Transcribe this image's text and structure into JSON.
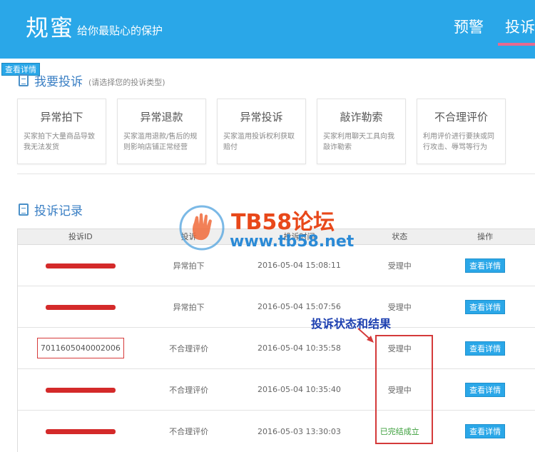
{
  "header": {
    "logo": "规蜜",
    "slogan": "给你最贴心的保护",
    "nav": [
      {
        "label": "预警"
      },
      {
        "label": "投诉"
      }
    ]
  },
  "float_button": "查看详情",
  "complain_section": {
    "title": "我要投诉",
    "subtitle": "(请选择您的投诉类型)",
    "cards": [
      {
        "title": "异常拍下",
        "desc": "买家拍下大量商品导致我无法发货"
      },
      {
        "title": "异常退款",
        "desc": "买家滥用退款/售后的规则影响店铺正常经营"
      },
      {
        "title": "异常投诉",
        "desc": "买家滥用投诉权利获取赔付"
      },
      {
        "title": "敲诈勒索",
        "desc": "买家利用聊天工具向我敲诈勒索"
      },
      {
        "title": "不合理评价",
        "desc": "利用评价进行要挟或同行攻击、辱骂等行为"
      }
    ]
  },
  "records_section": {
    "title": "投诉记录",
    "columns": [
      "投诉ID",
      "投诉",
      "投诉时间",
      "状态",
      "操作"
    ],
    "rows": [
      {
        "id": "",
        "type": "异常拍下",
        "time": "2016-05-04 15:08:11",
        "status": "受理中",
        "action": "查看详情"
      },
      {
        "id": "",
        "type": "异常拍下",
        "time": "2016-05-04 15:07:56",
        "status": "受理中",
        "action": "查看详情"
      },
      {
        "id": "7011605040002006",
        "type": "不合理评价",
        "time": "2016-05-04 10:35:58",
        "status": "受理中",
        "action": "查看详情"
      },
      {
        "id": "",
        "type": "不合理评价",
        "time": "2016-05-04 10:35:40",
        "status": "受理中",
        "action": "查看详情"
      },
      {
        "id": "",
        "type": "不合理评价",
        "time": "2016-05-03 13:30:03",
        "status": "已完结成立",
        "action": "查看详情"
      }
    ]
  },
  "annotation": {
    "text": "投诉状态和结果"
  },
  "watermark": {
    "title": "TB58论坛",
    "url": "www.tb58.net"
  },
  "colors": {
    "brand": "#2aa7e8",
    "annotation_red": "#d43a3a",
    "done_green": "#3a9e3a"
  }
}
